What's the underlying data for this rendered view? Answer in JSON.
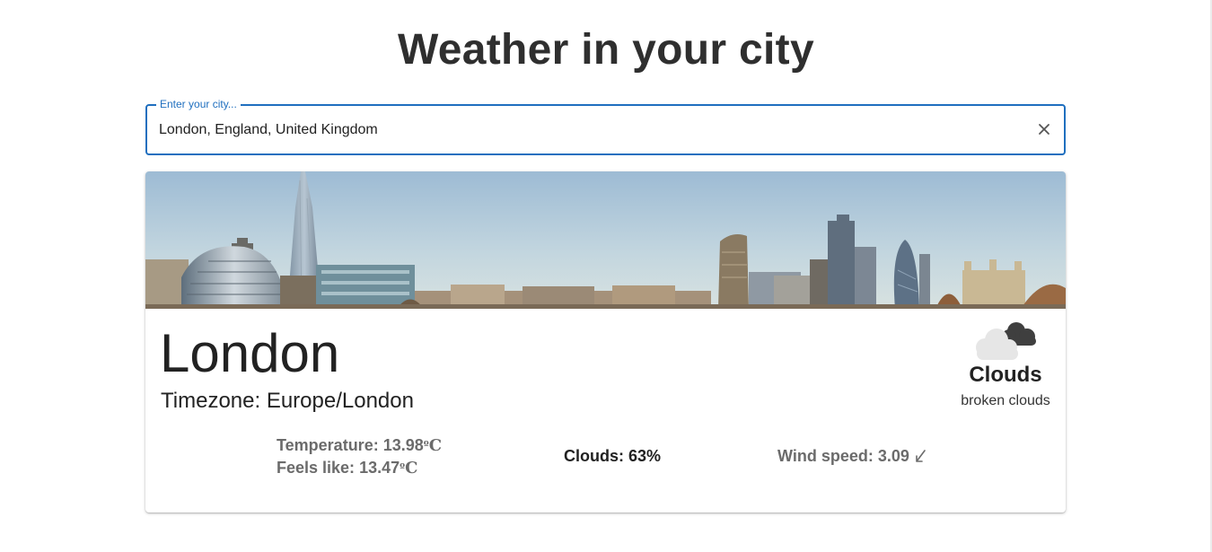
{
  "header": {
    "title": "Weather in your city"
  },
  "search": {
    "label": "Enter your city...",
    "value": "London, England, United Kingdom",
    "clear_icon": "close-icon"
  },
  "weather": {
    "city": "London",
    "timezone_label": "Timezone:",
    "timezone": "Europe/London",
    "condition_icon": "broken-clouds-icon",
    "condition": "Clouds",
    "description": "broken clouds",
    "temperature_label": "Temperature:",
    "temperature": "13.98",
    "feels_like_label": "Feels like:",
    "feels_like": "13.47",
    "temp_unit_symbol": "º",
    "temp_unit_letter": "C",
    "clouds_label": "Clouds:",
    "clouds": "63%",
    "wind_label": "Wind speed:",
    "wind": "3.09",
    "wind_icon": "wind-direction-arrow-icon"
  },
  "colors": {
    "accent": "#1f6fbf",
    "title": "#2f2f2f",
    "muted_stat": "#6b6b6b"
  }
}
